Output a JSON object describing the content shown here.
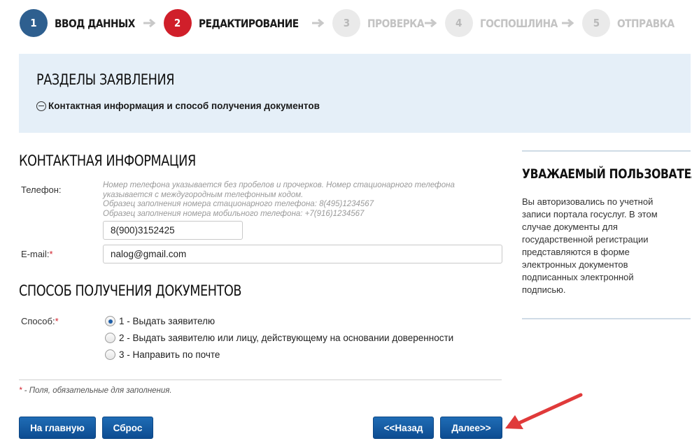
{
  "stepper": {
    "steps": [
      {
        "number": "1",
        "label": "ВВОД ДАННЫХ",
        "state": "done"
      },
      {
        "number": "2",
        "label": "РЕДАКТИРОВАНИЕ",
        "state": "active"
      },
      {
        "number": "3",
        "label": "ПРОВЕРКА",
        "state": "todo"
      },
      {
        "number": "4",
        "label": "ГОСПОШЛИНА",
        "state": "todo"
      },
      {
        "number": "5",
        "label": "ОТПРАВКА",
        "state": "todo"
      }
    ],
    "arrow_icon": "arrow-right-icon"
  },
  "sections": {
    "title": "РАЗДЕЛЫ ЗАЯВЛЕНИЯ",
    "item_icon": "collapse-minus-icon",
    "item_label": "Контактная информация и способ получения документов"
  },
  "contact": {
    "heading": "КОНТАКТНАЯ ИНФОРМАЦИЯ",
    "phone_label": "Телефон:",
    "phone_hint_1": "Номер телефона указывается без пробелов и прочерков. Номер стационарного телефона указывается с междугородным телефонным кодом.",
    "phone_hint_2": "Образец заполнения номера стационарного телефона: 8(495)1234567",
    "phone_hint_3": "Образец заполнения номера мобильного телефона: +7(916)1234567",
    "phone_value": "8(900)3152425",
    "email_label": "E-mail:",
    "required_mark": "*",
    "email_value": "nalog@gmail.com"
  },
  "delivery": {
    "heading": "СПОСОБ ПОЛУЧЕНИЯ ДОКУМЕНТОВ",
    "method_label": "Способ:",
    "required_mark": "*",
    "options": [
      {
        "label": "1 - Выдать заявителю",
        "checked": true
      },
      {
        "label": "2 - Выдать заявителю или лицу, действующему на основании доверенности",
        "checked": false
      },
      {
        "label": "3 - Направить по почте",
        "checked": false
      }
    ]
  },
  "footnote": {
    "mark": "*",
    "text": " - Поля, обязательные для заполнения."
  },
  "buttons": {
    "home": "На главную",
    "reset": "Сброс",
    "back": "<<Назад",
    "next": "Далее>>"
  },
  "sidebar": {
    "title": "УВАЖАЕМЫЙ ПОЛЬЗОВАТЕЛЬ!",
    "text": "Вы авторизовались по учетной записи портала госуслуг. В этом случае документы для государственной регистрации представляются в форме электронных документов подписанных электронной подписью."
  },
  "colors": {
    "brand_blue": "#2e5f8f",
    "active_red": "#d01f2a",
    "button_blue": "#1a63ab",
    "panel_bg": "#e5eff8",
    "annotation_red": "#e03a3a"
  }
}
